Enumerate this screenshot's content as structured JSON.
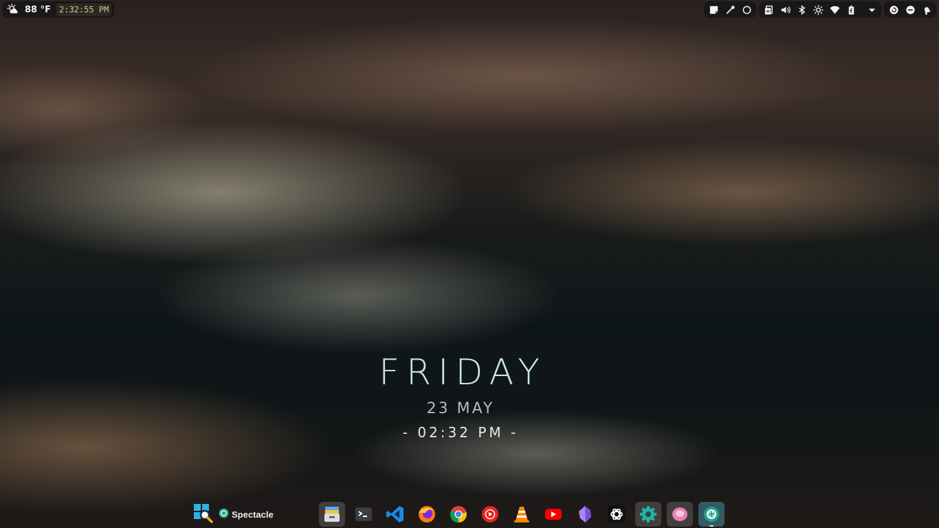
{
  "top_left": {
    "temperature": "88 °F",
    "clock": "2:32:55 PM"
  },
  "tray": {
    "icons": [
      "note-icon",
      "color-picker-icon",
      "record-icon",
      "clipboard-icon",
      "volume-icon",
      "bluetooth-icon",
      "brightness-icon",
      "wifi-icon",
      "battery-icon",
      "expand-arrow-icon",
      "refresh-icon",
      "minus-circle-icon",
      "notification-bell-icon"
    ]
  },
  "widget": {
    "day": "FRIDAY",
    "date": "23 MAY",
    "time": "- 02:32 PM -"
  },
  "taskbar": {
    "search_app": "search-app-icon",
    "spectacle_label": "Spectacle"
  },
  "dock": {
    "apps": [
      "archive-manager",
      "terminal",
      "vscode",
      "firefox",
      "chrome",
      "youtube-music",
      "vlc",
      "youtube",
      "obsidian",
      "chatgpt",
      "settings",
      "pink-app",
      "spectacle"
    ]
  }
}
